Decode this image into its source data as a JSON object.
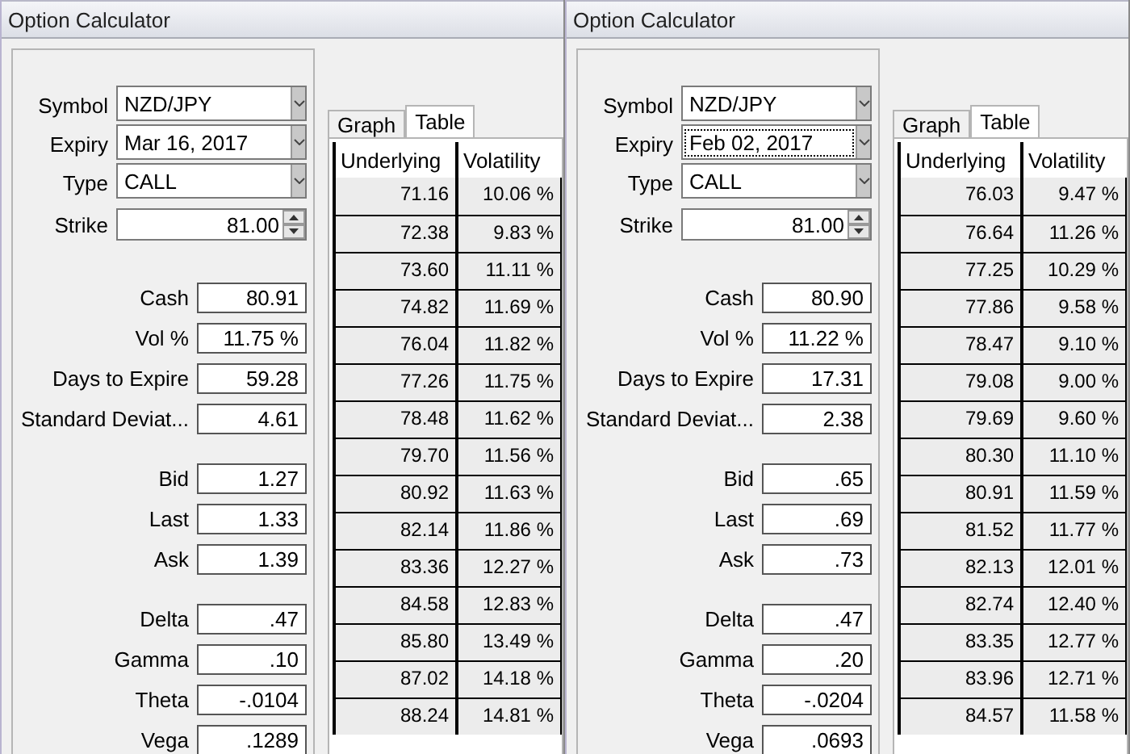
{
  "panels": [
    {
      "title": "Option Calculator",
      "selectors": [
        {
          "kind": "dropdown",
          "label": "Symbol",
          "value": "NZD/JPY",
          "focused": false
        },
        {
          "kind": "dropdown",
          "label": "Expiry",
          "value": "Mar 16, 2017",
          "focused": false
        },
        {
          "kind": "dropdown",
          "label": "Type",
          "value": "CALL",
          "focused": false
        },
        {
          "kind": "spinner",
          "label": "Strike",
          "value": "81.00",
          "focused": false
        }
      ],
      "groups": [
        [
          {
            "label": "Cash",
            "value": "80.91"
          },
          {
            "label": "Vol %",
            "value": "11.75 %"
          },
          {
            "label": "Days to Expire",
            "value": "59.28"
          },
          {
            "label": "Standard Deviat...",
            "value": "4.61"
          }
        ],
        [
          {
            "label": "Bid",
            "value": "1.27"
          },
          {
            "label": "Last",
            "value": "1.33"
          },
          {
            "label": "Ask",
            "value": "1.39"
          }
        ],
        [
          {
            "label": "Delta",
            "value": ".47"
          },
          {
            "label": "Gamma",
            "value": ".10"
          },
          {
            "label": "Theta",
            "value": "-.0104"
          },
          {
            "label": "Vega",
            "value": ".1289"
          }
        ]
      ],
      "tabs": [
        {
          "label": "Graph",
          "selected": false
        },
        {
          "label": "Table",
          "selected": true
        }
      ],
      "table": {
        "columns": [
          "Underlying",
          "Volatility"
        ],
        "rows": [
          [
            "71.16",
            "10.06 %"
          ],
          [
            "72.38",
            "9.83 %"
          ],
          [
            "73.60",
            "11.11 %"
          ],
          [
            "74.82",
            "11.69 %"
          ],
          [
            "76.04",
            "11.82 %"
          ],
          [
            "77.26",
            "11.75 %"
          ],
          [
            "78.48",
            "11.62 %"
          ],
          [
            "79.70",
            "11.56 %"
          ],
          [
            "80.92",
            "11.63 %"
          ],
          [
            "82.14",
            "11.86 %"
          ],
          [
            "83.36",
            "12.27 %"
          ],
          [
            "84.58",
            "12.83 %"
          ],
          [
            "85.80",
            "13.49 %"
          ],
          [
            "87.02",
            "14.18 %"
          ],
          [
            "88.24",
            "14.81 %"
          ]
        ]
      }
    },
    {
      "title": "Option Calculator",
      "selectors": [
        {
          "kind": "dropdown",
          "label": "Symbol",
          "value": "NZD/JPY",
          "focused": false
        },
        {
          "kind": "dropdown",
          "label": "Expiry",
          "value": "Feb 02, 2017",
          "focused": true
        },
        {
          "kind": "dropdown",
          "label": "Type",
          "value": "CALL",
          "focused": false
        },
        {
          "kind": "spinner",
          "label": "Strike",
          "value": "81.00",
          "focused": false
        }
      ],
      "groups": [
        [
          {
            "label": "Cash",
            "value": "80.90"
          },
          {
            "label": "Vol %",
            "value": "11.22 %"
          },
          {
            "label": "Days to Expire",
            "value": "17.31"
          },
          {
            "label": "Standard Deviat...",
            "value": "2.38"
          }
        ],
        [
          {
            "label": "Bid",
            "value": ".65"
          },
          {
            "label": "Last",
            "value": ".69"
          },
          {
            "label": "Ask",
            "value": ".73"
          }
        ],
        [
          {
            "label": "Delta",
            "value": ".47"
          },
          {
            "label": "Gamma",
            "value": ".20"
          },
          {
            "label": "Theta",
            "value": "-.0204"
          },
          {
            "label": "Vega",
            "value": ".0693"
          }
        ]
      ],
      "tabs": [
        {
          "label": "Graph",
          "selected": false
        },
        {
          "label": "Table",
          "selected": true
        }
      ],
      "table": {
        "columns": [
          "Underlying",
          "Volatility"
        ],
        "rows": [
          [
            "76.03",
            "9.47 %"
          ],
          [
            "76.64",
            "11.26 %"
          ],
          [
            "77.25",
            "10.29 %"
          ],
          [
            "77.86",
            "9.58 %"
          ],
          [
            "78.47",
            "9.10 %"
          ],
          [
            "79.08",
            "9.00 %"
          ],
          [
            "79.69",
            "9.60 %"
          ],
          [
            "80.30",
            "11.10 %"
          ],
          [
            "80.91",
            "11.59 %"
          ],
          [
            "81.52",
            "11.77 %"
          ],
          [
            "82.13",
            "12.01 %"
          ],
          [
            "82.74",
            "12.40 %"
          ],
          [
            "83.35",
            "12.77 %"
          ],
          [
            "83.96",
            "12.71 %"
          ],
          [
            "84.57",
            "11.58 %"
          ]
        ]
      }
    }
  ]
}
